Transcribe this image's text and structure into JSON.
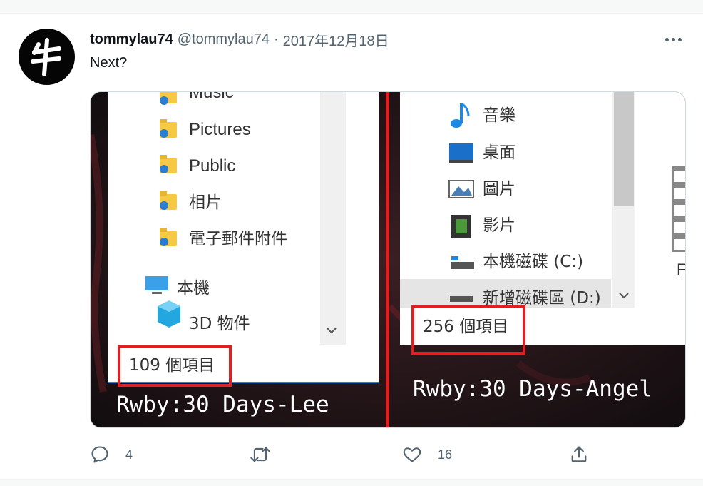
{
  "tweet": {
    "display_name": "tommylau74",
    "handle": "@tommylau74",
    "separator": "·",
    "date": "2017年12月18日",
    "text": "Next?",
    "more_icon": "more-horizontal-icon"
  },
  "media": {
    "left_panel": {
      "items": [
        {
          "label": "Music",
          "icon": "sync-folder-icon"
        },
        {
          "label": "Pictures",
          "icon": "sync-folder-icon"
        },
        {
          "label": "Public",
          "icon": "sync-folder-icon"
        },
        {
          "label": "相片",
          "icon": "sync-folder-icon"
        },
        {
          "label": "電子郵件附件",
          "icon": "sync-folder-icon"
        },
        {
          "label": "本機",
          "icon": "computer-icon"
        },
        {
          "label": "3D 物件",
          "icon": "3d-objects-icon"
        }
      ],
      "status": "109 個項目",
      "caption": "Rwby:30 Days-Lee"
    },
    "right_panel": {
      "items": [
        {
          "label": "音樂",
          "icon": "music-note-icon"
        },
        {
          "label": "桌面",
          "icon": "desktop-icon"
        },
        {
          "label": "圖片",
          "icon": "pictures-icon"
        },
        {
          "label": "影片",
          "icon": "film-icon"
        },
        {
          "label": "本機磁碟 (C:)",
          "icon": "drive-icon"
        },
        {
          "label": "新增磁碟區 (D:)",
          "icon": "drive-icon"
        }
      ],
      "status": "256 個項目",
      "caption": "Rwby:30 Days-Angel",
      "edge_letter": "F"
    },
    "highlight_color": "#e02020"
  },
  "actions": {
    "reply_count": "4",
    "retweet_count": "",
    "like_count": "16",
    "icons": [
      "reply-icon",
      "retweet-icon",
      "like-icon",
      "share-icon"
    ]
  },
  "colors": {
    "text_primary": "#0f1419",
    "text_secondary": "#536471",
    "border": "#cfd9de"
  }
}
